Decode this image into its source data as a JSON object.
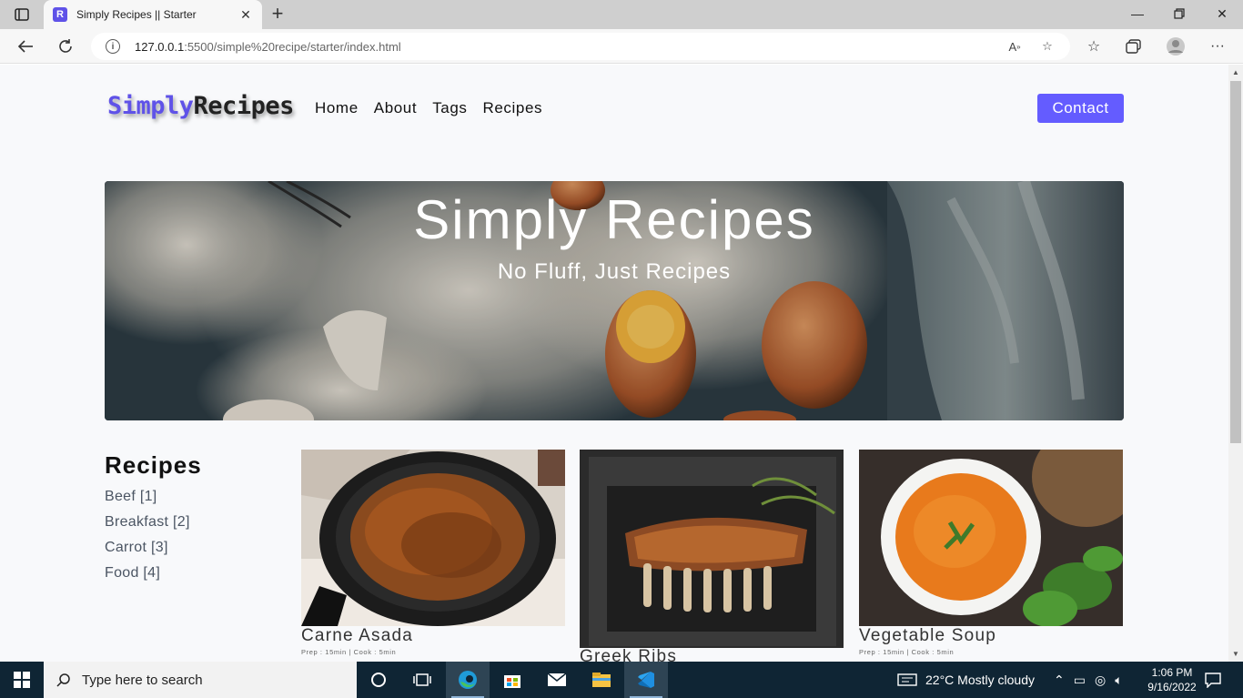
{
  "browser": {
    "tab_title": "Simply Recipes || Starter",
    "url_host": "127.0.0.1",
    "url_path": ":5500/simple%20recipe/starter/index.html"
  },
  "page": {
    "logo_part1": "Simply",
    "logo_part2": "Recipes",
    "nav": [
      "Home",
      "About",
      "Tags",
      "Recipes"
    ],
    "contact_label": "Contact",
    "hero": {
      "title": "Simply Recipes",
      "subtitle": "No Fluff, Just Recipes"
    },
    "sidebar": {
      "title": "Recipes",
      "items": [
        "Beef [1]",
        "Breakfast [2]",
        "Carrot [3]",
        "Food [4]"
      ]
    },
    "recipes": [
      {
        "name": "Carne Asada",
        "meta": "Prep : 15min | Cook : 5min"
      },
      {
        "name": "Greek Ribs",
        "meta": ""
      },
      {
        "name": "Vegetable Soup",
        "meta": "Prep : 15min | Cook : 5min"
      }
    ],
    "accent_color": "#645cff"
  },
  "taskbar": {
    "search_placeholder": "Type here to search",
    "weather": "22°C  Mostly cloudy",
    "time": "1:06 PM",
    "date": "9/16/2022"
  }
}
